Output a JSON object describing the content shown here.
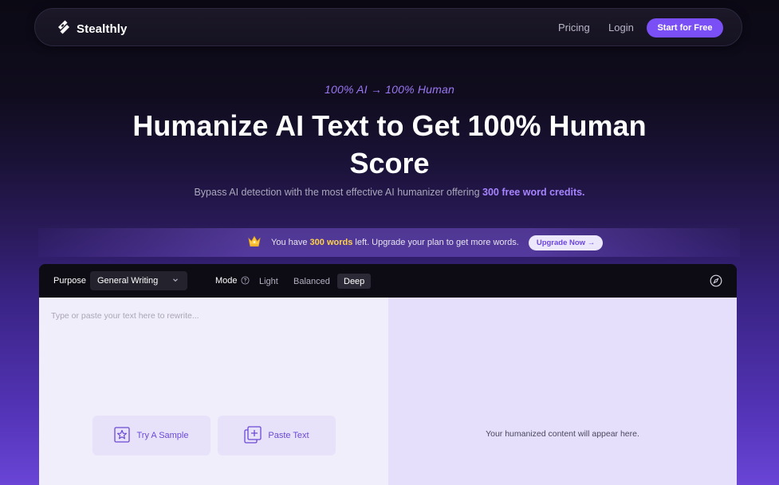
{
  "nav": {
    "brand": "Stealthly",
    "links": [
      "Pricing",
      "Login"
    ],
    "cta": "Start for Free"
  },
  "hero": {
    "tagline": "100% AI → 100% Human",
    "headline": "Humanize AI Text to Get 100% Human Score",
    "subhead_prefix": "Bypass AI detection with the most effective AI humanizer offering ",
    "subhead_highlight": "300 free word credits."
  },
  "banner": {
    "prefix": "You have ",
    "amount": "300 words",
    "suffix": " left. Upgrade your plan to get more words.",
    "upgrade_label": "Upgrade Now →"
  },
  "toolbar": {
    "purpose_label": "Purpose",
    "purpose_value": "General Writing",
    "mode_label": "Mode",
    "modes": [
      "Light",
      "Balanced",
      "Deep"
    ],
    "selected_mode": "Deep"
  },
  "editor": {
    "input_placeholder": "Type or paste your text here to rewrite...",
    "try_sample": "Try A Sample",
    "paste_text": "Paste Text",
    "output_placeholder": "Your humanized content will appear here."
  },
  "colors": {
    "accent": "#7b4ff6",
    "highlight": "#a683ff",
    "credits": "#ffd24a"
  },
  "icons": [
    "logo-icon",
    "crown-icon",
    "chevron-down-icon",
    "help-icon",
    "compass-icon",
    "star-icon",
    "paste-icon"
  ]
}
